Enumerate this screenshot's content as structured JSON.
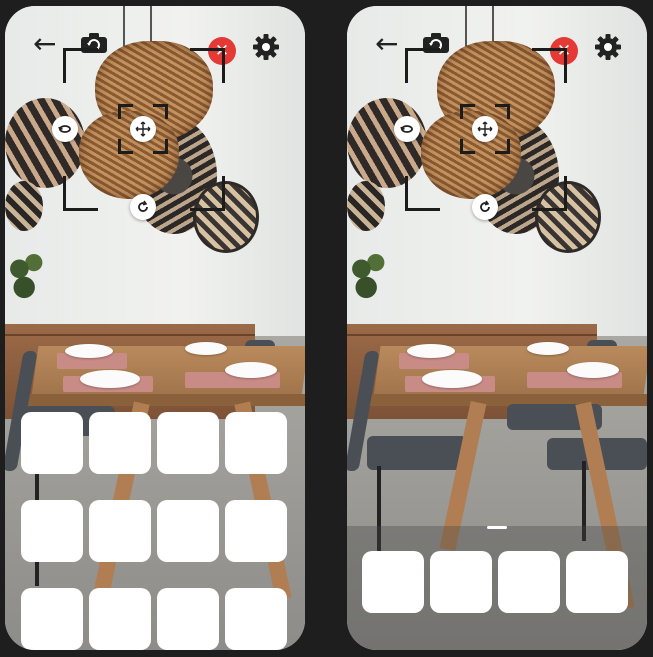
{
  "screens": [
    {
      "id": "left",
      "state": "expanded",
      "tile_rows": 3,
      "tile_count": 12
    },
    {
      "id": "right",
      "state": "collapsed",
      "tile_rows": 1,
      "tile_count": 4
    }
  ],
  "toolbar": {
    "back": "back-arrow-icon",
    "camera": "camera-flip-icon",
    "close": "close-icon",
    "settings": "gear-icon",
    "close_symbol": "✕",
    "back_symbol": "←"
  },
  "handles": {
    "flip": "flip-icon",
    "move": "move-arrows-icon",
    "rotate": "rotate-icon"
  },
  "colors": {
    "close_button": "#e53935",
    "tile": "#ffffff",
    "background": "#1e1e1e"
  }
}
